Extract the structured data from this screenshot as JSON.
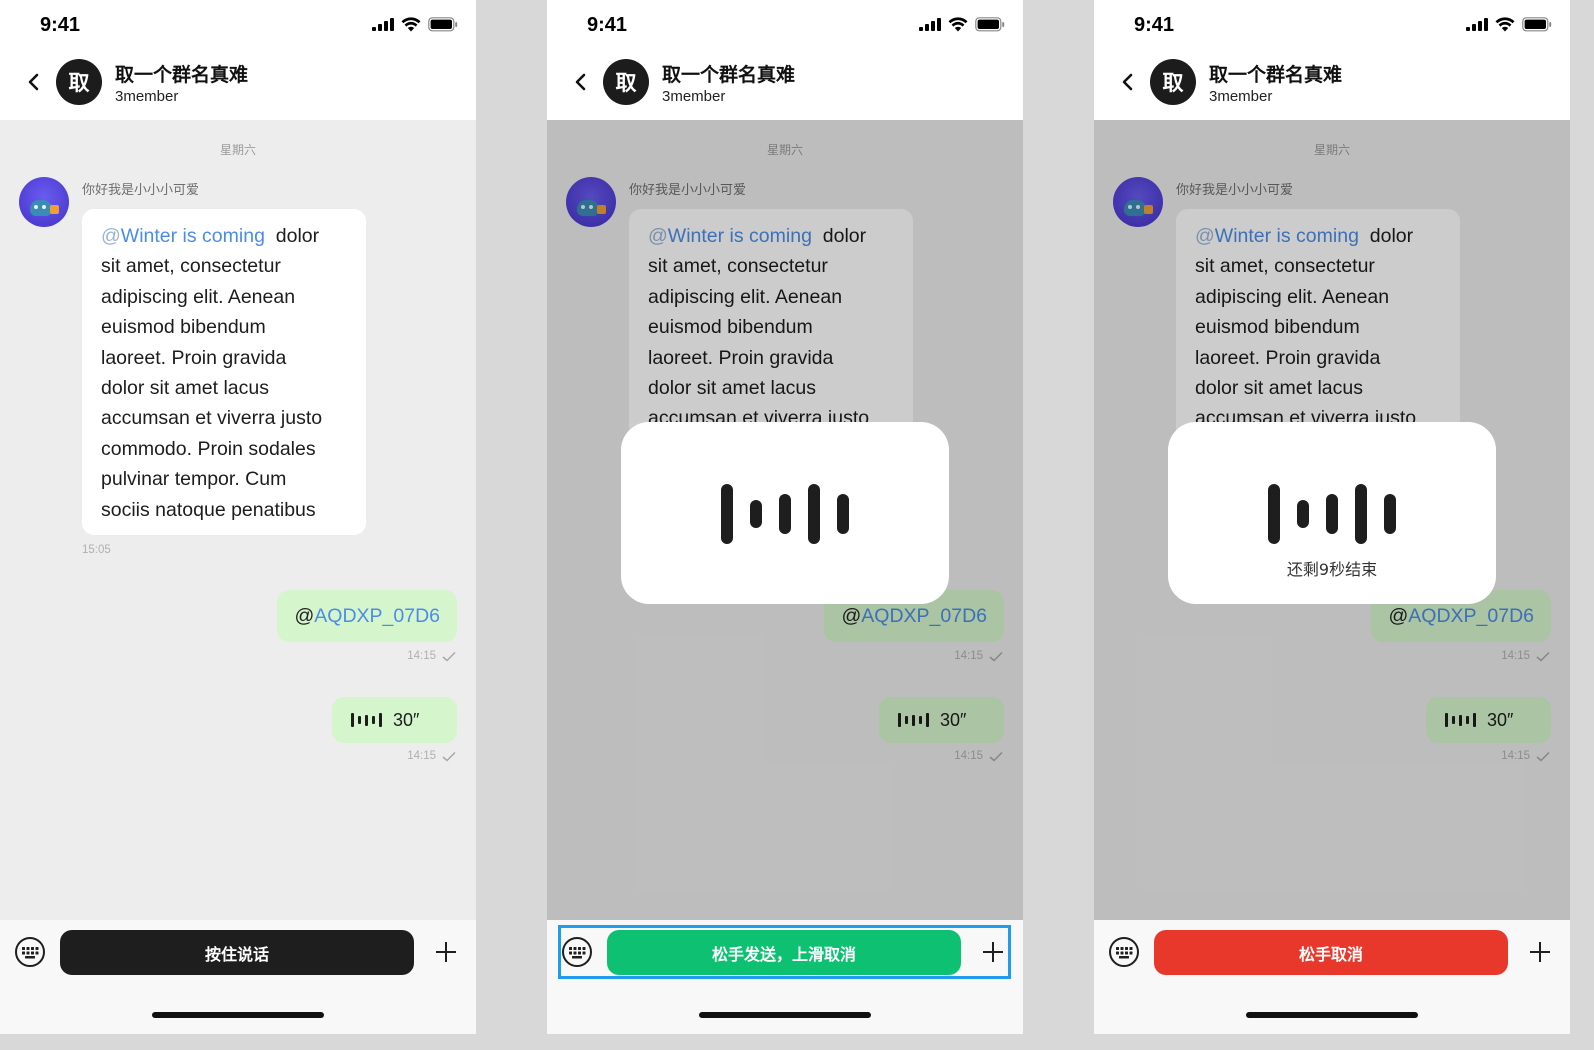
{
  "status": {
    "time": "9:41"
  },
  "header": {
    "avatar_char": "取",
    "title": "取一个群名真难",
    "subtitle": "3member"
  },
  "chat": {
    "date_divider": "星期六",
    "sender_name": "你好我是小小小可爱",
    "incoming": {
      "mention_at": "@",
      "mention_name": "Winter is coming",
      "first_tail": "dolor",
      "lines": [
        "sit amet, consectetur",
        "adipiscing elit. Aenean",
        "euismod bibendum",
        "laoreet. Proin gravida",
        "dolor sit amet lacus",
        "accumsan et viverra justo",
        "commodo. Proin sodales",
        "pulvinar tempor. Cum",
        "sociis natoque penatibus"
      ],
      "time": "15:05"
    },
    "outgoing_mention": {
      "at": "@",
      "name": "AQDXP_07D6",
      "time": "14:15"
    },
    "outgoing_voice": {
      "duration": "30″",
      "time": "14:15"
    }
  },
  "screens": [
    {
      "button_label": "按住说话",
      "button_color": "#1e1e1e",
      "dimmed": false,
      "hud": null
    },
    {
      "button_label": "松手发送，上滑取消",
      "button_color": "#0ec172",
      "dimmed": true,
      "hud": {
        "caption": ""
      }
    },
    {
      "button_label": "松手取消",
      "button_color": "#e8382c",
      "dimmed": true,
      "hud": {
        "caption": "还剩9秒结束"
      }
    }
  ],
  "colors": {
    "highlight": "#1f9bf0",
    "out_bubble": "#d5f5cd",
    "mention": "#4b8ce8"
  },
  "icons": {
    "back": "chevron-left-icon",
    "keyboard": "keyboard-icon",
    "plus": "plus-icon",
    "read": "check-icon"
  }
}
